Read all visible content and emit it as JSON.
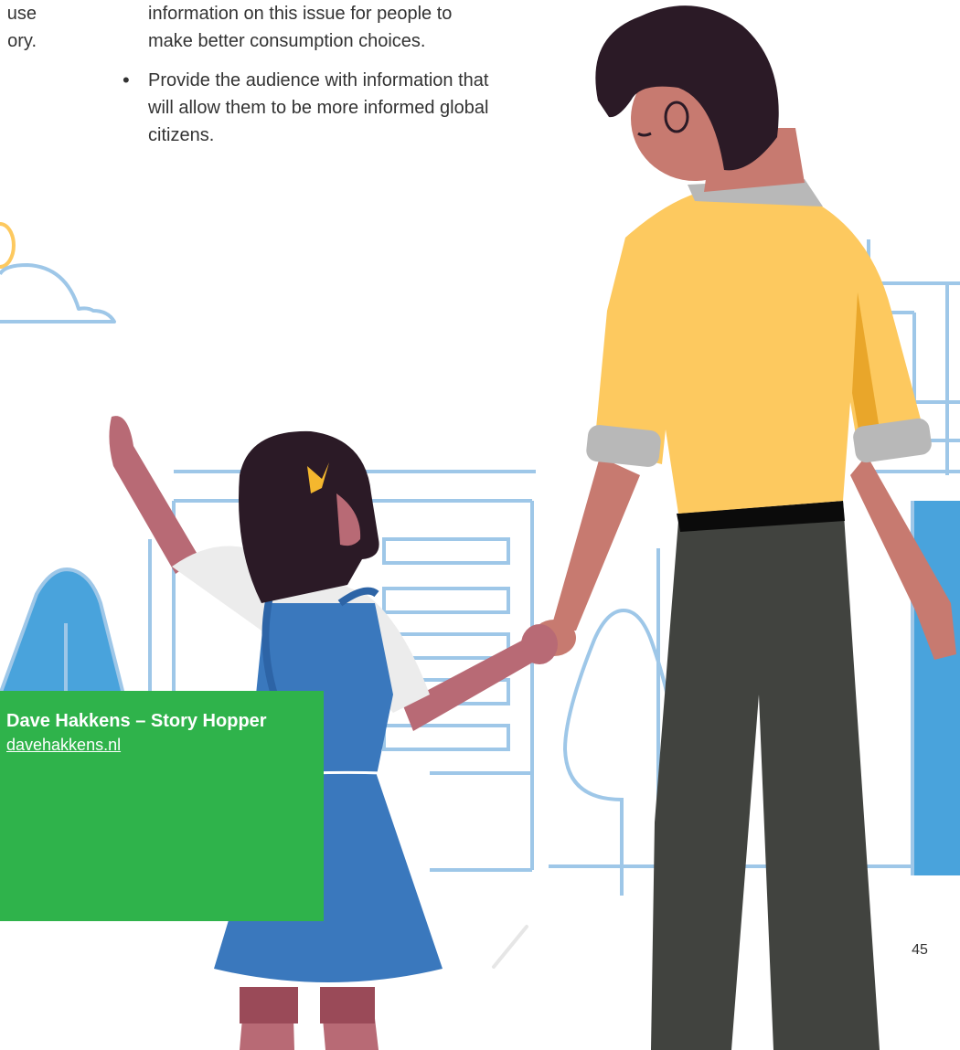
{
  "text_fragments": {
    "left_line_1": "use",
    "left_line_2": "ory."
  },
  "bullets": [
    {
      "text": "information on this issue for people to make better consumption choices."
    },
    {
      "text": "Provide the audience with information that will allow them to be more informed global citizens."
    }
  ],
  "credit": {
    "title": "Dave Hakkens – Story Hopper",
    "link": "davehakkens.nl"
  },
  "page_number": "45",
  "colors": {
    "green_box": "#2fb34b",
    "shirt_yellow": "#fdc95f",
    "skin": "#c77a70",
    "hair": "#2b1a26",
    "trousers": "#41433f",
    "dress_blue": "#3a78bd",
    "line_blue": "#9ec7e8",
    "fill_blue": "#49a3dc"
  }
}
